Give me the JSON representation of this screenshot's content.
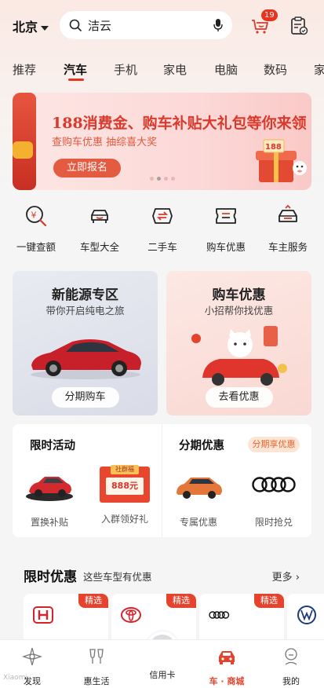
{
  "header": {
    "city": "北京",
    "search_text": "洁云",
    "cart_badge": "19"
  },
  "tabs": [
    {
      "label": "推荐"
    },
    {
      "label": "汽车",
      "active": true
    },
    {
      "label": "手机"
    },
    {
      "label": "家电"
    },
    {
      "label": "电脑"
    },
    {
      "label": "数码"
    },
    {
      "label": "家"
    }
  ],
  "banner": {
    "title": "188消费金、购车补贴大礼包等你来领",
    "subtitle": "查购车优惠 抽综喜大奖",
    "button": "立即报名",
    "gift_text": "188",
    "page_count": 4,
    "active_page": 2
  },
  "quick_links": [
    {
      "label": "一键查额",
      "icon": "yuan-search-icon"
    },
    {
      "label": "车型大全",
      "icon": "car-front-icon"
    },
    {
      "label": "二手车",
      "icon": "swap-tag-icon"
    },
    {
      "label": "购车优惠",
      "icon": "coupon-icon"
    },
    {
      "label": "车主服务",
      "icon": "car-service-icon"
    }
  ],
  "promo_cards": {
    "nev": {
      "title": "新能源专区",
      "subtitle": "带你开启纯电之旅",
      "button": "分期购车"
    },
    "buy": {
      "title": "购车优惠",
      "subtitle": "小招帮你找优惠",
      "button": "去看优惠"
    }
  },
  "activity": {
    "left_title": "限时活动",
    "right_title": "分期优惠",
    "right_tag": "分期享优惠",
    "items": [
      {
        "label": "置换补贴"
      },
      {
        "label": "入群领好礼",
        "badge": "社群福",
        "amount": "888元"
      },
      {
        "label": "专属优惠"
      },
      {
        "label": "限时抢兑"
      }
    ]
  },
  "deals": {
    "title": "限时优惠",
    "subtitle": "这些车型有优惠",
    "more": "更多",
    "cards": [
      {
        "badge": "精选",
        "brand_icon": "honda-logo-icon"
      },
      {
        "badge": "精选",
        "brand_icon": "toyota-logo-icon"
      },
      {
        "badge": "精选",
        "brand_icon": "audi-logo-icon"
      },
      {
        "badge": "",
        "brand_icon": "vw-logo-icon"
      }
    ]
  },
  "bottom_nav": [
    {
      "label": "发现",
      "icon": "discover-icon"
    },
    {
      "label": "惠生活",
      "icon": "cheers-icon"
    },
    {
      "label": "信用卡",
      "icon": "credit-card-icon"
    },
    {
      "label": "车 · 商城",
      "icon": "car-mall-icon",
      "active": true
    },
    {
      "label": "我的",
      "icon": "profile-icon"
    }
  ],
  "watermark": "Xiaomi",
  "colors": {
    "accent": "#e5432d",
    "tag_orange": "#e56630"
  }
}
